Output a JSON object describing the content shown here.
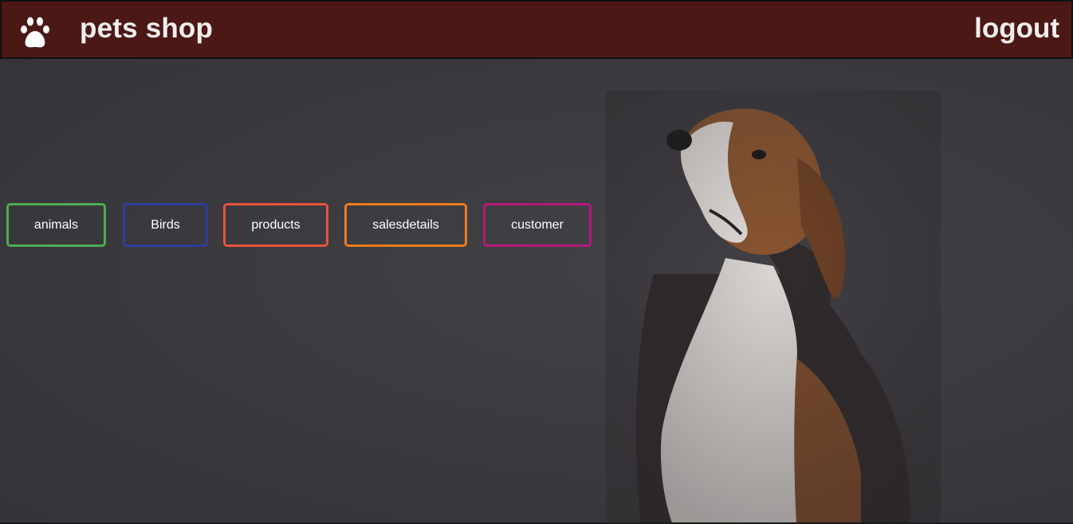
{
  "header": {
    "brand": "pets shop",
    "logout_label": "logout",
    "logo_icon": "paw-icon",
    "background_color": "#4b1816"
  },
  "nav": {
    "buttons": [
      {
        "label": "animals",
        "color": "#4caf50"
      },
      {
        "label": "Birds",
        "color": "#2d3f9a"
      },
      {
        "label": "products",
        "color": "#e8523e"
      },
      {
        "label": "salesdetails",
        "color": "#f07a1e"
      },
      {
        "label": "customer",
        "color": "#b3197a"
      }
    ]
  },
  "hero": {
    "image": "beagle-dog-photo"
  }
}
